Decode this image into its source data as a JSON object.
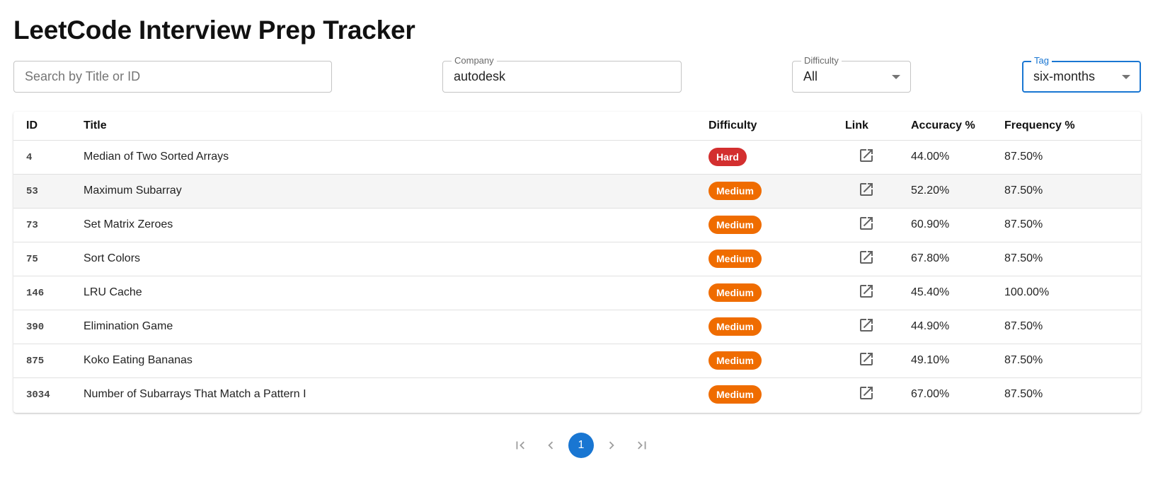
{
  "page": {
    "title": "LeetCode Interview Prep Tracker"
  },
  "filters": {
    "search": {
      "placeholder": "Search by Title or ID",
      "value": ""
    },
    "company": {
      "label": "Company",
      "value": "autodesk"
    },
    "difficulty": {
      "label": "Difficulty",
      "value": "All"
    },
    "tag": {
      "label": "Tag",
      "value": "six-months"
    }
  },
  "table": {
    "columns": [
      "ID",
      "Title",
      "Difficulty",
      "Link",
      "Accuracy %",
      "Frequency %"
    ],
    "rows": [
      {
        "id": "4",
        "title": "Median of Two Sorted Arrays",
        "difficulty": "Hard",
        "accuracy": "44.00%",
        "frequency": "87.50%"
      },
      {
        "id": "53",
        "title": "Maximum Subarray",
        "difficulty": "Medium",
        "accuracy": "52.20%",
        "frequency": "87.50%"
      },
      {
        "id": "73",
        "title": "Set Matrix Zeroes",
        "difficulty": "Medium",
        "accuracy": "60.90%",
        "frequency": "87.50%"
      },
      {
        "id": "75",
        "title": "Sort Colors",
        "difficulty": "Medium",
        "accuracy": "67.80%",
        "frequency": "87.50%"
      },
      {
        "id": "146",
        "title": "LRU Cache",
        "difficulty": "Medium",
        "accuracy": "45.40%",
        "frequency": "100.00%"
      },
      {
        "id": "390",
        "title": "Elimination Game",
        "difficulty": "Medium",
        "accuracy": "44.90%",
        "frequency": "87.50%"
      },
      {
        "id": "875",
        "title": "Koko Eating Bananas",
        "difficulty": "Medium",
        "accuracy": "49.10%",
        "frequency": "87.50%"
      },
      {
        "id": "3034",
        "title": "Number of Subarrays That Match a Pattern I",
        "difficulty": "Medium",
        "accuracy": "67.00%",
        "frequency": "87.50%"
      }
    ],
    "link_icon": "open-in-new-icon",
    "difficulty_colors": {
      "Hard": "#d32f2f",
      "Medium": "#ef6c00",
      "Easy": "#2e7d32"
    }
  },
  "pagination": {
    "current_page": "1",
    "icons": [
      "first-page-icon",
      "chevron-left-icon",
      "chevron-right-icon",
      "last-page-icon"
    ]
  },
  "colors": {
    "accent": "#1976d2",
    "hover_row": "#f5f5f5"
  }
}
